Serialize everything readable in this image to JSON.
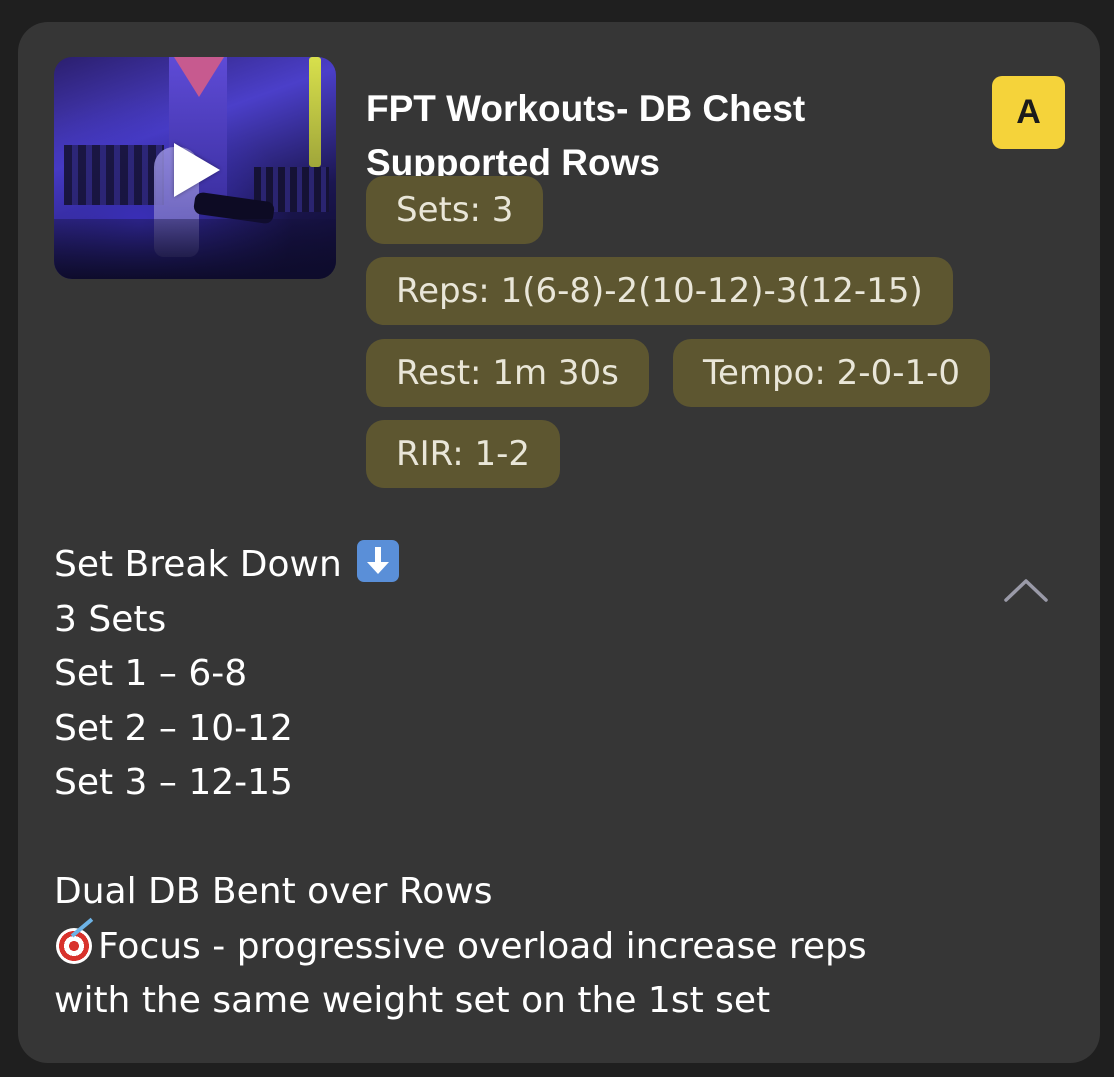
{
  "workout": {
    "title": "FPT Workouts- DB Chest Supported Rows",
    "badge": "A",
    "video_icon": "play-icon"
  },
  "chips": {
    "sets": "Sets: 3",
    "reps": "Reps: 1(6-8)-2(10-12)-3(12-15)",
    "rest": "Rest: 1m 30s",
    "tempo": "Tempo: 2-0-1-0",
    "rir": "RIR: 1-2"
  },
  "description": {
    "heading": "Set Break Down",
    "heading_icon": "down-arrow-emoji",
    "lines": [
      "3 Sets",
      "Set 1 – 6-8",
      "Set 2 – 10-12",
      "Set 3 – 12-15"
    ],
    "exercise": "Dual DB Bent over Rows",
    "focus_icon": "target-emoji",
    "focus_line1": "Focus - progressive overload increase reps",
    "focus_line2": "with the same weight set on the 1st set",
    "collapse_icon": "chevron-up-icon"
  },
  "colors": {
    "card": "#363636",
    "chip": "#5d5630",
    "badge": "#f5d33a"
  }
}
